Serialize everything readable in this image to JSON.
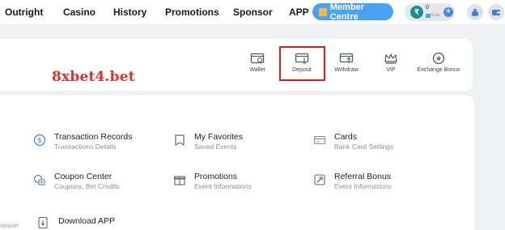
{
  "nav": {
    "items": [
      "Outright",
      "Casino",
      "History",
      "Promotions",
      "Sponsor",
      "APP"
    ],
    "member_centre": "Member Centre"
  },
  "balance": {
    "amount": "0",
    "points": "0 pts",
    "currency_symbol": "₹"
  },
  "brand": "8xbet4.bet",
  "actions": [
    {
      "label": "Wallet",
      "icon": "wallet-icon"
    },
    {
      "label": "Deposit",
      "icon": "deposit-icon"
    },
    {
      "label": "Withdraw",
      "icon": "withdraw-icon"
    },
    {
      "label": "VIP",
      "icon": "crown-icon"
    },
    {
      "label": "Exchange Bonus",
      "icon": "star-icon"
    }
  ],
  "menu": [
    {
      "title": "Transaction Records",
      "subtitle": "Transactions Details",
      "icon": "dollar-icon"
    },
    {
      "title": "My Favorites",
      "subtitle": "Saved Events",
      "icon": "bookmark-icon"
    },
    {
      "title": "Cards",
      "subtitle": "Bank Card Settings",
      "icon": "card-icon"
    },
    {
      "title": "Coupon Center",
      "subtitle": "Coupons, Bet Credits",
      "icon": "coupon-icon"
    },
    {
      "title": "Promotions",
      "subtitle": "Event Informations",
      "icon": "gift-icon"
    },
    {
      "title": "Referral Bonus",
      "subtitle": "Event Informations",
      "icon": "referral-icon"
    },
    {
      "title": "Download APP",
      "subtitle": "",
      "icon": "download-icon"
    }
  ],
  "clipped_text": "nission",
  "colors": {
    "accent_blue": "#4aa3f0",
    "highlight_red": "#e01b1b",
    "brand_red": "#e0302a"
  }
}
